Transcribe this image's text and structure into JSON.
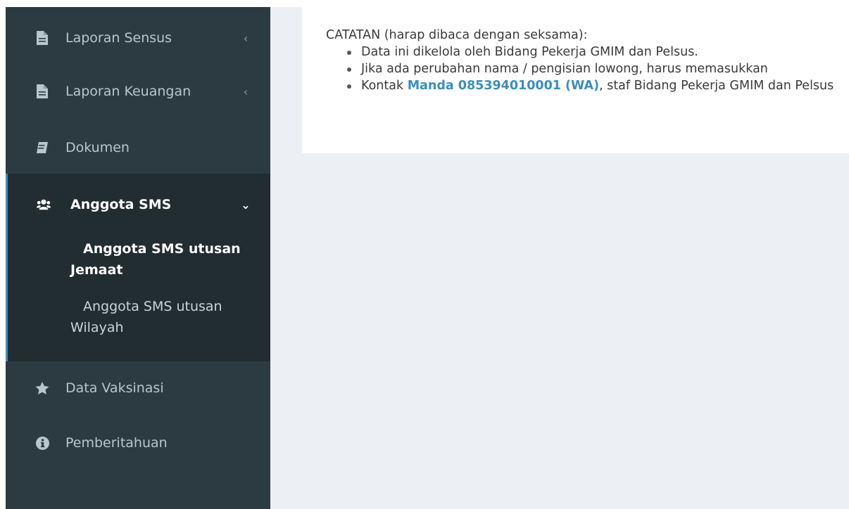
{
  "sidebar": {
    "items": [
      {
        "label": "Laporan Sensus",
        "icon": "file-icon",
        "chevron": "‹"
      },
      {
        "label": "Laporan Keuangan",
        "icon": "file-icon",
        "chevron": "‹"
      },
      {
        "label": "Dokumen",
        "icon": "book-icon"
      },
      {
        "label": "Anggota SMS",
        "icon": "users-icon",
        "chevron": "⌄"
      },
      {
        "label": "Data Vaksinasi",
        "icon": "star-icon"
      },
      {
        "label": "Pemberitahuan",
        "icon": "info-icon"
      }
    ],
    "submenu": [
      {
        "line1": "Anggota SMS utusan",
        "line2": "Jemaat"
      },
      {
        "line1": "Anggota SMS utusan",
        "line2": "Wilayah"
      }
    ],
    "colors": {
      "bg": "#2c3b41",
      "active_bg": "#222d32",
      "accent": "#3c8dbc"
    }
  },
  "main": {
    "note_title": "CATATAN (harap dibaca dengan seksama):",
    "bullets": {
      "b1": "Data ini dikelola oleh Bidang Pekerja GMIM dan Pelsus.",
      "b2": "Jika ada perubahan nama / pengisian lowong, harus memasukkan",
      "b3_prefix": "Kontak ",
      "b3_link": "Manda 085394010001 (WA)",
      "b3_suffix": ", staf Bidang Pekerja GMIM dan Pelsus"
    },
    "link_color": "#3c8dbc"
  }
}
